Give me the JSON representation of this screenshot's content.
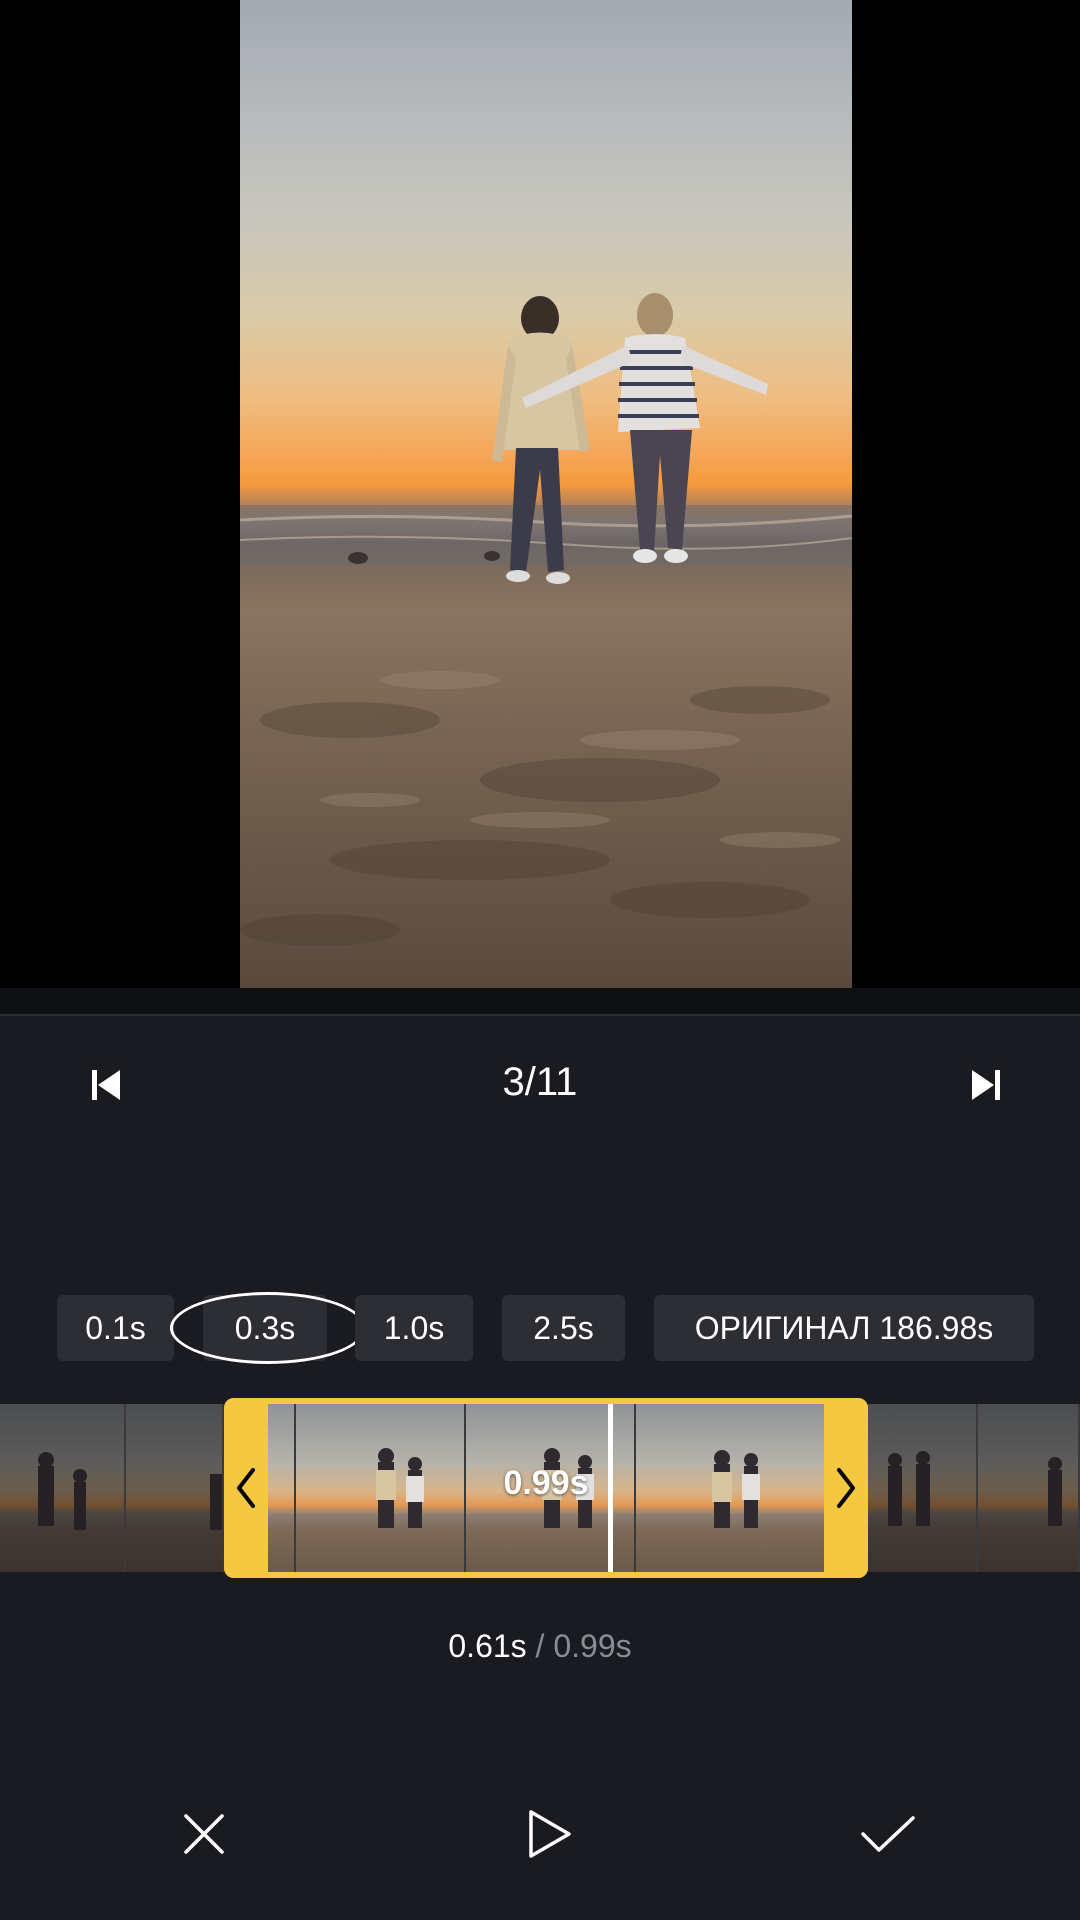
{
  "navigation": {
    "counter": "3/11",
    "prev_icon": "skip-previous-icon",
    "next_icon": "skip-next-icon"
  },
  "presets": [
    {
      "label": "0.1s",
      "selected": false
    },
    {
      "label": "0.3s",
      "selected": true
    },
    {
      "label": "1.0s",
      "selected": false
    },
    {
      "label": "2.5s",
      "selected": false
    },
    {
      "label": "ОРИГИНАЛ 186.98s",
      "selected": false
    }
  ],
  "timeline": {
    "clip_duration": "0.99s",
    "left_handle_icon": "chevron-left-icon",
    "right_handle_icon": "chevron-right-icon"
  },
  "time": {
    "current": "0.61s",
    "separator": " / ",
    "total": "0.99s"
  },
  "actions": {
    "cancel_icon": "close-icon",
    "play_icon": "play-icon",
    "confirm_icon": "checkmark-icon"
  },
  "colors": {
    "accent": "#f5c842",
    "background": "#191b20",
    "button": "#2c2e34",
    "muted_text": "#8a8c92"
  }
}
